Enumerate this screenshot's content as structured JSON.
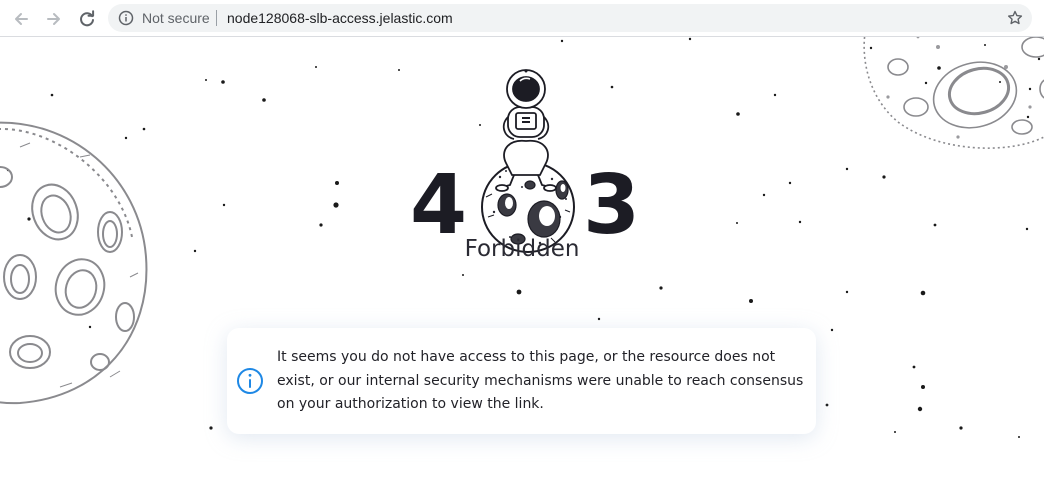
{
  "browser": {
    "security_label": "Not secure",
    "url": "node128068-slb-access.jelastic.com",
    "icons": {
      "back": "arrow-left-icon",
      "forward": "arrow-right-icon",
      "reload": "reload-icon",
      "site_info": "info-circle-icon",
      "bookmark": "star-icon"
    }
  },
  "error": {
    "digit_first": "4",
    "digit_last": "3",
    "middle_illustration": "astronaut-on-asteroid",
    "status": "Forbidden"
  },
  "notice": {
    "icon": "info-circle-icon",
    "message": "It seems you do not have access to this page, or the resource does not exist, or our internal security mechanisms were unable to reach consensus on your authorization to view the link."
  },
  "colors": {
    "accent": "#1e88e5",
    "digits": "#1c1c24",
    "moon_stroke": "#8a8a8e"
  }
}
